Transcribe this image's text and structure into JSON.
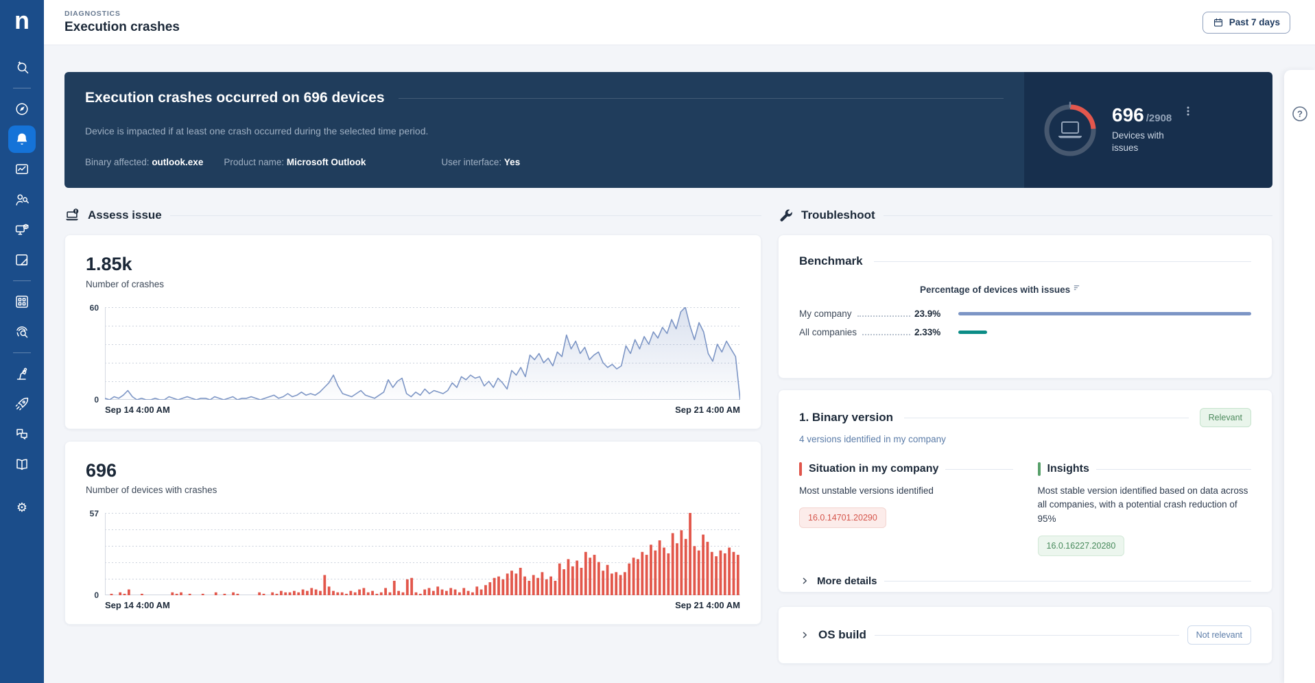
{
  "app": {
    "logo_text": "n"
  },
  "icons": {
    "help_glyph": "?"
  },
  "header": {
    "breadcrumb": "DIAGNOSTICS",
    "title": "Execution crashes",
    "date_filter": "Past 7 days"
  },
  "sidebar": {
    "items": [
      {
        "icon": "search-sparkle"
      },
      {
        "divider": true
      },
      {
        "icon": "compass"
      },
      {
        "icon": "bell",
        "active": true
      },
      {
        "icon": "monitor-chart"
      },
      {
        "icon": "person-search"
      },
      {
        "icon": "device-cube"
      },
      {
        "icon": "note-edit"
      },
      {
        "divider": true
      },
      {
        "icon": "apps-grid"
      },
      {
        "icon": "fingerprint-search"
      },
      {
        "divider": true
      },
      {
        "icon": "robot-arm"
      },
      {
        "icon": "rocket"
      },
      {
        "icon": "chat-bubbles"
      },
      {
        "icon": "book"
      },
      {
        "spacer": true
      },
      {
        "icon": "gear"
      }
    ]
  },
  "banner": {
    "title": "Execution crashes occurred on 696 devices",
    "subtitle": "Device is impacted if at least one crash occurred during the selected time period.",
    "facts": [
      {
        "label": "Binary affected: ",
        "value": "outlook.exe"
      },
      {
        "label": "Product name: ",
        "value": "Microsoft Outlook"
      },
      {
        "label": "User interface: ",
        "value": "Yes"
      }
    ],
    "gauge": {
      "value": "696",
      "total": "/2908",
      "caption": "Devices with issues",
      "percent": 23.9,
      "ring_color": "#47586f",
      "arc_color": "#e4574d"
    }
  },
  "assess": {
    "section_title": "Assess issue"
  },
  "chart_data": [
    {
      "type": "line",
      "metric": "1.85k",
      "title": "Number of crashes",
      "ylim": [
        0,
        60
      ],
      "x_start": "Sep 14 4:00 AM",
      "x_end": "Sep 21 4:00 AM",
      "grid": "horizontal-dotted",
      "legend": "none",
      "color": "#7c95c5",
      "values": [
        1,
        0,
        2,
        1,
        3,
        6,
        2,
        0,
        1,
        0,
        0,
        1,
        0,
        0,
        2,
        1,
        0,
        1,
        2,
        1,
        0,
        1,
        1,
        0,
        2,
        1,
        0,
        1,
        2,
        0,
        1,
        1,
        2,
        1,
        0,
        1,
        2,
        3,
        1,
        2,
        4,
        2,
        3,
        5,
        3,
        4,
        3,
        5,
        8,
        11,
        16,
        9,
        4,
        3,
        2,
        4,
        6,
        3,
        2,
        1,
        3,
        5,
        13,
        8,
        12,
        14,
        4,
        2,
        5,
        3,
        7,
        4,
        6,
        5,
        4,
        6,
        11,
        8,
        15,
        13,
        16,
        14,
        15,
        9,
        12,
        8,
        14,
        11,
        7,
        19,
        16,
        21,
        15,
        29,
        26,
        30,
        24,
        27,
        22,
        31,
        28,
        42,
        33,
        38,
        30,
        34,
        26,
        29,
        31,
        24,
        21,
        23,
        20,
        22,
        35,
        30,
        39,
        33,
        41,
        36,
        44,
        40,
        47,
        43,
        52,
        46,
        57,
        60,
        48,
        39,
        50,
        44,
        30,
        25,
        36,
        31,
        38,
        33,
        28,
        0
      ]
    },
    {
      "type": "bar",
      "metric": "696",
      "title": "Number of devices with crashes",
      "ylim": [
        0,
        57
      ],
      "x_start": "Sep 14 4:00 AM",
      "x_end": "Sep 21 4:00 AM",
      "grid": "horizontal-dotted",
      "legend": "none",
      "color": "#e2574b",
      "values": [
        0,
        1,
        0,
        2,
        1,
        4,
        0,
        0,
        1,
        0,
        0,
        0,
        0,
        0,
        0,
        2,
        1,
        2,
        0,
        1,
        0,
        0,
        1,
        0,
        0,
        2,
        0,
        1,
        0,
        2,
        1,
        0,
        0,
        0,
        0,
        2,
        1,
        0,
        2,
        1,
        3,
        2,
        2,
        3,
        2,
        4,
        3,
        5,
        4,
        3,
        14,
        6,
        3,
        2,
        2,
        1,
        3,
        2,
        4,
        5,
        2,
        3,
        1,
        2,
        5,
        2,
        10,
        3,
        2,
        11,
        12,
        2,
        1,
        4,
        5,
        3,
        6,
        4,
        3,
        5,
        4,
        2,
        5,
        3,
        2,
        6,
        4,
        7,
        9,
        12,
        13,
        11,
        15,
        17,
        15,
        19,
        13,
        10,
        14,
        12,
        16,
        11,
        13,
        10,
        22,
        18,
        25,
        20,
        24,
        19,
        30,
        26,
        28,
        23,
        17,
        21,
        15,
        16,
        14,
        16,
        22,
        26,
        25,
        30,
        28,
        35,
        31,
        38,
        33,
        29,
        43,
        36,
        45,
        39,
        57,
        34,
        31,
        42,
        37,
        30,
        27,
        31,
        29,
        33,
        30,
        28
      ]
    }
  ],
  "troubleshoot": {
    "section_title": "Troubleshoot",
    "benchmark": {
      "title": "Benchmark",
      "column_header": "Percentage of devices with issues",
      "rows": [
        {
          "label": "My company",
          "value": "23.9%",
          "pct": 23.9,
          "color": "#7c95c5"
        },
        {
          "label": "All companies",
          "value": "2.33%",
          "pct": 2.33,
          "color": "#0b8c86"
        }
      ]
    },
    "binary": {
      "title": "1. Binary version",
      "badge": "Relevant",
      "subtitle": "4 versions identified in my company",
      "situation": {
        "title": "Situation in my company",
        "desc": "Most unstable versions identified",
        "chip": "16.0.14701.20290"
      },
      "insights": {
        "title": "Insights",
        "desc": "Most stable version identified based on data across all companies, with a potential crash reduction of 95%",
        "chip": "16.0.16227.20280"
      },
      "more_label": "More details"
    },
    "os_build": {
      "title": "OS build",
      "badge": "Not relevant"
    }
  }
}
